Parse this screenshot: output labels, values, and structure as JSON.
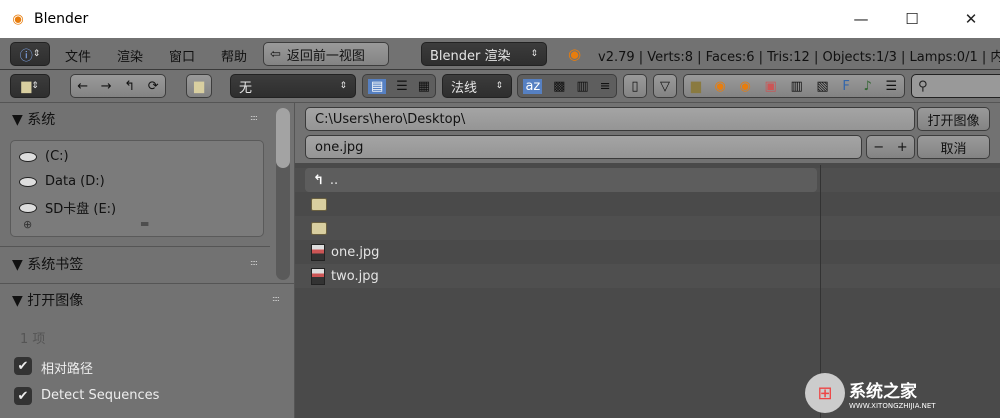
{
  "window": {
    "title": "Blender",
    "minimize": "—",
    "maximize": "☐",
    "close": "✕"
  },
  "menubar": {
    "menus": [
      "文件",
      "渲染",
      "窗口",
      "帮助"
    ],
    "back_button": "返回前一视图",
    "render_engine": "Blender 渲染",
    "stats": "v2.79 | Verts:8 | Faces:6 | Tris:12 | Objects:1/3 | Lamps:0/1 | 内"
  },
  "toolbar": {
    "recent_dropdown": "无",
    "sort_dropdown": "法线"
  },
  "sidebar": {
    "system_header": "系统",
    "drives": [
      "(C:)",
      "Data (D:)",
      "SD卡盘 (E:)"
    ],
    "bookmarks_header": "系统书签",
    "open_image_header": "打开图像",
    "item_count": "1 项",
    "relative_path": {
      "label": "相对路径",
      "checked": true
    },
    "detect_sequences": {
      "label": "Detect Sequences",
      "checked": true
    }
  },
  "main": {
    "directory": "C:\\Users\\hero\\Desktop\\",
    "filename": "one.jpg",
    "open_button": "打开图像",
    "cancel_button": "取消",
    "minus": "−",
    "plus": "+",
    "files": [
      {
        "name": "..",
        "type": "parent"
      },
      {
        "name": "",
        "type": "folder"
      },
      {
        "name": "",
        "type": "folder"
      },
      {
        "name": "one.jpg",
        "type": "image"
      },
      {
        "name": "two.jpg",
        "type": "image"
      }
    ]
  },
  "watermark": {
    "text": "系统之家",
    "url": "WWW.XITONGZHIJIA.NET"
  }
}
